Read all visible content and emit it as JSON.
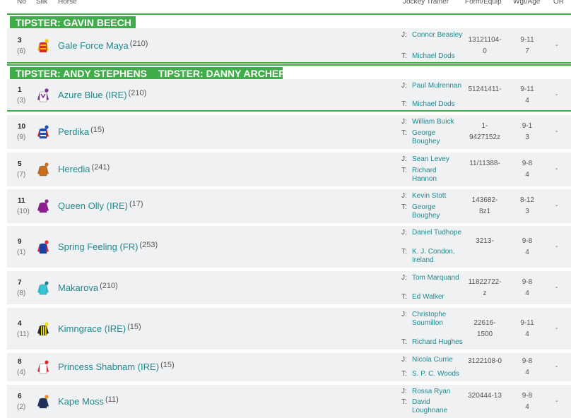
{
  "columns": {
    "no": "No",
    "silk": "Silk",
    "horse": "Horse",
    "jockey_trainer": "Jockey Trainer",
    "form": "Form/Equip",
    "wgt": "Wgt/Age",
    "or": "OR"
  },
  "labels": {
    "jockey": "J:",
    "trainer": "T:"
  },
  "colors": {
    "accent": "#3fae49",
    "link": "#1f8a8e",
    "row_bg": "#f0f1f3"
  },
  "tipster_groups": [
    {
      "tags": [
        "TIPSTER: GAVIN BEECH"
      ]
    },
    {
      "tags": [
        "TIPSTER: ANDY STEPHENS",
        "TIPSTER: DANNY ARCHER"
      ]
    }
  ],
  "runners": [
    {
      "no": "3",
      "draw": "(6)",
      "horse": "Gale Force Maya",
      "rating": "(210)",
      "jockey": "Connor Beasley",
      "trainer": "Michael Dods",
      "form": "13121104-0",
      "wgt": "9-11",
      "age": "7",
      "or": "-",
      "silk": {
        "body": "#e8262a",
        "sleeve": "#f6c600",
        "cap": "#f6c600",
        "pattern": "stripes"
      }
    },
    {
      "no": "1",
      "draw": "(3)",
      "horse": "Azure Blue (IRE)",
      "rating": "(210)",
      "jockey": "Paul Mulrennan",
      "trainer": "Michael Dods",
      "form": "51241411-",
      "wgt": "9-11",
      "age": "4",
      "or": "-",
      "silk": {
        "body": "#ffffff",
        "sleeve": "#7a2b8e",
        "cap": "#7a2b8e",
        "pattern": "chevron"
      }
    },
    {
      "no": "10",
      "draw": "(9)",
      "horse": "Perdika",
      "rating": "(15)",
      "jockey": "William Buick",
      "trainer": "George Boughey",
      "form": "1-9427152z",
      "wgt": "9-1",
      "age": "3",
      "or": "-",
      "silk": {
        "body": "#1e4fb8",
        "sleeve": "#d22",
        "cap": "#1e4fb8",
        "pattern": "hoops"
      }
    },
    {
      "no": "5",
      "draw": "(7)",
      "horse": "Heredia",
      "rating": "(241)",
      "jockey": "Sean Levey",
      "trainer": "Richard Hannon",
      "form": "11/11388-",
      "wgt": "9-8",
      "age": "4",
      "or": "-",
      "silk": {
        "body": "#c9701c",
        "sleeve": "#c9701c",
        "cap": "#c9701c",
        "pattern": "plain"
      }
    },
    {
      "no": "11",
      "draw": "(10)",
      "horse": "Queen Olly (IRE)",
      "rating": "(17)",
      "jockey": "Kevin Stott",
      "trainer": "George Boughey",
      "form": "143682-8z1",
      "wgt": "8-12",
      "age": "3",
      "or": "-",
      "silk": {
        "body": "#8e1c8e",
        "sleeve": "#8e1c8e",
        "cap": "#8e1c8e",
        "pattern": "plain"
      }
    },
    {
      "no": "9",
      "draw": "(1)",
      "horse": "Spring Feeling (FR)",
      "rating": "(253)",
      "jockey": "Daniel Tudhope",
      "trainer": "K. J. Condon, Ireland",
      "form": "3213-",
      "wgt": "9-8",
      "age": "4",
      "or": "-",
      "silk": {
        "body": "#1e3fa8",
        "sleeve": "#e8262a",
        "cap": "#e8262a",
        "pattern": "plain"
      }
    },
    {
      "no": "7",
      "draw": "(8)",
      "horse": "Makarova",
      "rating": "(210)",
      "jockey": "Tom Marquand",
      "trainer": "Ed Walker",
      "form": "11822722-z",
      "wgt": "9-8",
      "age": "4",
      "or": "-",
      "silk": {
        "body": "#33c6d6",
        "sleeve": "#33c6d6",
        "cap": "#1a7f8a",
        "pattern": "plain"
      }
    },
    {
      "no": "4",
      "draw": "(11)",
      "horse": "Kimngrace (IRE)",
      "rating": "(15)",
      "jockey": "Christophe Soumillon",
      "trainer": "Richard Hughes",
      "form": "22616-1500",
      "wgt": "9-11",
      "age": "4",
      "or": "-",
      "silk": {
        "body": "#222222",
        "sleeve": "#222222",
        "cap": "#f2e200",
        "pattern": "vstripes"
      }
    },
    {
      "no": "8",
      "draw": "(4)",
      "horse": "Princess Shabnam (IRE)",
      "rating": "(15)",
      "jockey": "Nicola Currie",
      "trainer": "S. P. C. Woods",
      "form": "3122108-0",
      "wgt": "9-8",
      "age": "4",
      "or": "-",
      "silk": {
        "body": "#ffffff",
        "sleeve": "#e8262a",
        "cap": "#e8262a",
        "pattern": "plain"
      }
    },
    {
      "no": "6",
      "draw": "(2)",
      "horse": "Kape Moss",
      "rating": "(11)",
      "jockey": "Rossa Ryan",
      "trainer": "David Loughnane",
      "form": "320444-13",
      "wgt": "9-8",
      "age": "4",
      "or": "-",
      "silk": {
        "body": "#1c2e5c",
        "sleeve": "#1c2e5c",
        "cap": "#f08a24",
        "pattern": "plain"
      }
    }
  ]
}
